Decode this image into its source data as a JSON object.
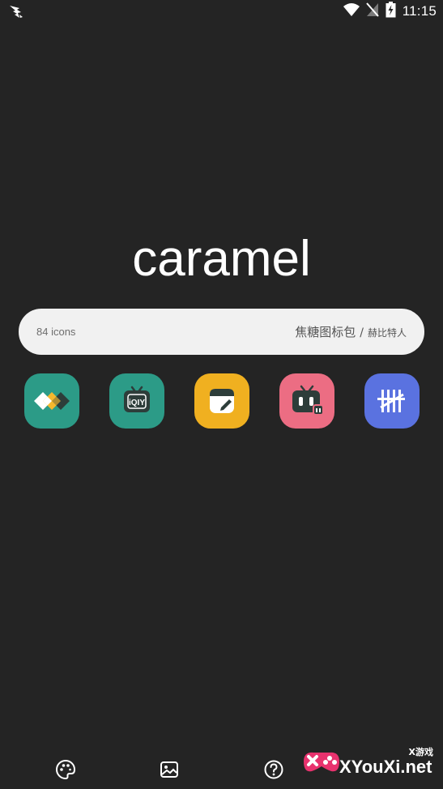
{
  "status_bar": {
    "time": "11:15",
    "icons": [
      "notification-bird-icon",
      "wifi-icon",
      "signal-off-icon",
      "battery-charging-icon"
    ]
  },
  "app": {
    "title": "caramel"
  },
  "info_pill": {
    "icon_count": "84 icons",
    "pack_name": "焦糖图标包",
    "separator": "/",
    "author": "赫比特人"
  },
  "preview_icons": [
    {
      "name": "diamond-app-icon",
      "bg": "#2c9b87"
    },
    {
      "name": "iqiyi-tv-icon",
      "bg": "#2c9b87",
      "label": "iQIY"
    },
    {
      "name": "notes-app-icon",
      "bg": "#f0b020"
    },
    {
      "name": "bilibili-tv-icon",
      "bg": "#ec6d83"
    },
    {
      "name": "tally-app-icon",
      "bg": "#5a72e0"
    }
  ],
  "bottom_nav": {
    "items": [
      "palette-icon",
      "wallpaper-icon",
      "help-icon"
    ]
  },
  "watermark": {
    "small_text": "X游戏",
    "big_text": "XYouXi.net"
  },
  "colors": {
    "background": "#242424",
    "pill": "#f1f1f1",
    "text_light": "#ffffff",
    "text_dark": "#555555"
  }
}
